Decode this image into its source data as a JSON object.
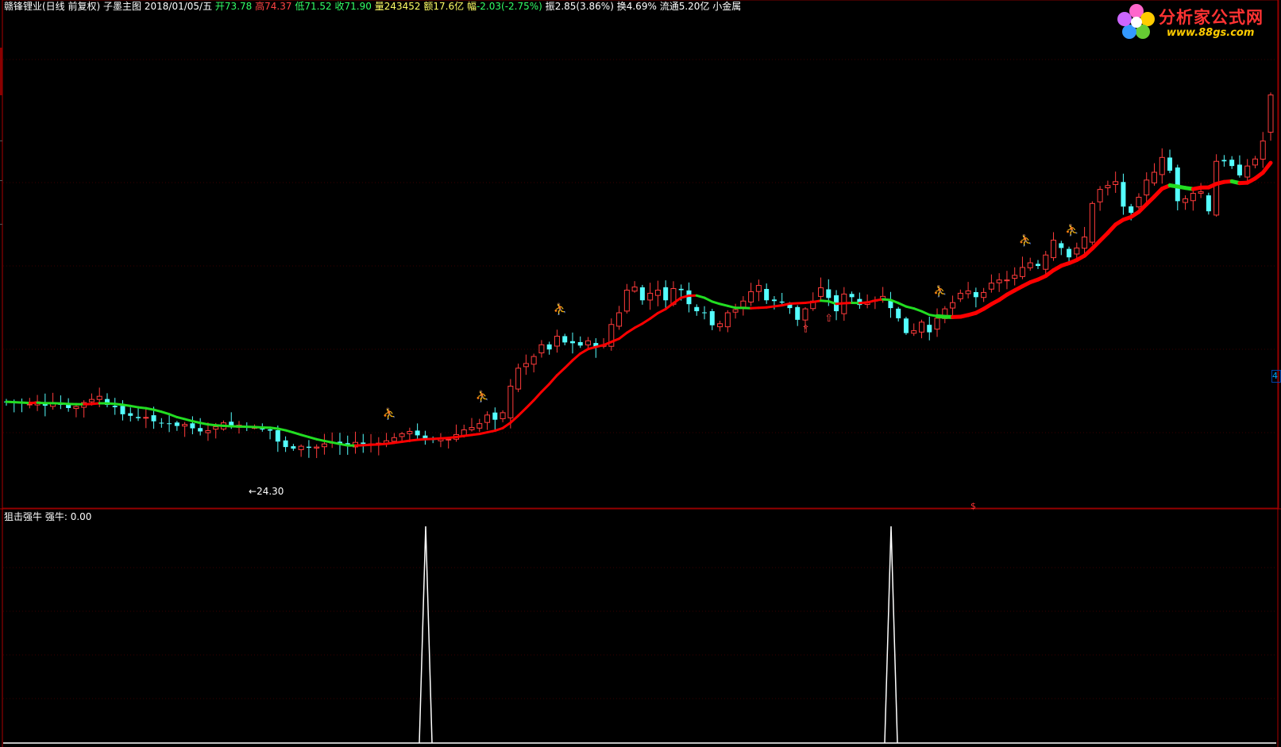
{
  "header": {
    "name": "赣锋锂业(日线 前复权)",
    "main_chart": "子墨主图",
    "date": "2018/01/05/五",
    "open_label": "开",
    "open": "73.78",
    "high_label": "高",
    "high": "74.37",
    "low_label": "低",
    "low": "71.52",
    "close_label": "收",
    "close": "71.90",
    "volume_label": "量",
    "volume": "243452",
    "amount_label": "额",
    "amount": "17.6亿",
    "change_label": "幅",
    "change": "-2.03(-2.75%)",
    "amplitude_label": "振",
    "amplitude": "2.85(3.86%)",
    "turnover_label": "换",
    "turnover": "4.69%",
    "float_label": "流通",
    "float_cap": "5.20亿",
    "sector": "小金属"
  },
  "logo": {
    "title": "分析家公式网",
    "url": "www.88gs.com"
  },
  "low_marker": "24.30",
  "right_label": "4",
  "dollar_marker": "$",
  "indicator": {
    "title": "狙击强牛",
    "series_label": "强牛:",
    "value": "0.00"
  },
  "colors": {
    "up": "#ff3b3b",
    "down": "#54ffff",
    "ma_up": "#ff0000",
    "ma_down": "#22dd22",
    "signal": "#ffffff",
    "grid": "#7f0000"
  },
  "chart_data": [
    {
      "type": "candlestick",
      "title": "",
      "ylim": [
        20,
        80
      ],
      "low_annotation": 24.3,
      "x_count": 160,
      "candles_note": "price series visible as OHLC bars; approximate values",
      "close": [
        32.6,
        32.5,
        32.4,
        32.3,
        32.6,
        32.1,
        32.4,
        32.2,
        31.8,
        32.0,
        32.5,
        32.9,
        33.3,
        32.2,
        31.9,
        31.0,
        30.8,
        30.5,
        30.6,
        30.1,
        29.9,
        29.8,
        29.5,
        29.7,
        29.2,
        28.8,
        28.9,
        29.4,
        29.9,
        29.5,
        29.6,
        29.4,
        29.3,
        29.1,
        28.9,
        27.5,
        26.8,
        26.6,
        26.9,
        26.7,
        26.8,
        27.2,
        27.4,
        27.1,
        27.0,
        27.4,
        27.2,
        27.2,
        27.3,
        27.6,
        28.0,
        28.5,
        28.8,
        28.3,
        27.8,
        27.7,
        27.9,
        27.8,
        28.4,
        29.0,
        29.3,
        29.8,
        30.9,
        30.3,
        31.2,
        34.6,
        36.9,
        37.5,
        38.4,
        39.9,
        39.3,
        41.0,
        40.2,
        40.1,
        39.8,
        40.4,
        39.6,
        39.9,
        42.5,
        44.0,
        46.9,
        47.3,
        45.6,
        46.5,
        46.9,
        45.6,
        47.1,
        46.9,
        45.1,
        44.2,
        44.0,
        42.4,
        42.6,
        44.0,
        44.4,
        45.5,
        46.7,
        47.5,
        45.6,
        45.5,
        45.3,
        44.6,
        43.1,
        44.5,
        45.5,
        47.2,
        45.9,
        44.2,
        46.4,
        46.0,
        45.0,
        45.4,
        45.6,
        46.1,
        44.6,
        43.3,
        41.4,
        41.7,
        42.8,
        41.5,
        43.3,
        44.5,
        45.3,
        46.5,
        46.8,
        46.0,
        46.6,
        47.8,
        48.2,
        48.2,
        48.8,
        49.8,
        50.4,
        50.0,
        51.4,
        53.3,
        52.3,
        51.1,
        52.3,
        53.7,
        58.0,
        59.8,
        60.3,
        60.8,
        57.6,
        56.8,
        58.8,
        61.0,
        62.0,
        63.9,
        62.2,
        58.3,
        58.6,
        59.3,
        59.5,
        57.0,
        63.4,
        63.4,
        62.8,
        61.6,
        62.8,
        63.7,
        66.0,
        71.9
      ],
      "ma_note": "smoothed trend line; red when rising, green when falling"
    },
    {
      "type": "line",
      "title": "狙击强牛",
      "series": [
        {
          "name": "强牛",
          "spikes_at_index": [
            52,
            110
          ],
          "baseline": 0,
          "peak": 1
        }
      ],
      "ylim": [
        0,
        1
      ]
    }
  ]
}
